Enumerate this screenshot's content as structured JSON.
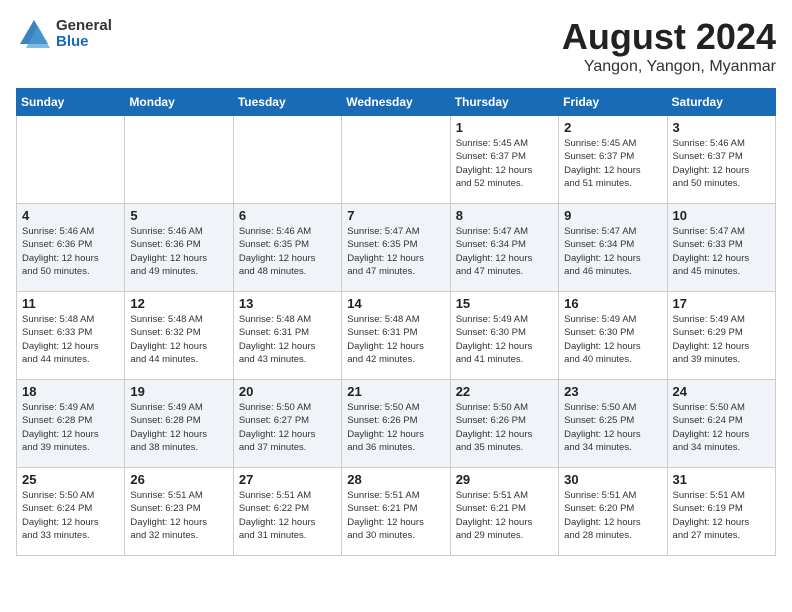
{
  "header": {
    "logo_general": "General",
    "logo_blue": "Blue",
    "month_year": "August 2024",
    "location": "Yangon, Yangon, Myanmar"
  },
  "days_of_week": [
    "Sunday",
    "Monday",
    "Tuesday",
    "Wednesday",
    "Thursday",
    "Friday",
    "Saturday"
  ],
  "weeks": [
    [
      {
        "day": "",
        "info": ""
      },
      {
        "day": "",
        "info": ""
      },
      {
        "day": "",
        "info": ""
      },
      {
        "day": "",
        "info": ""
      },
      {
        "day": "1",
        "info": "Sunrise: 5:45 AM\nSunset: 6:37 PM\nDaylight: 12 hours\nand 52 minutes."
      },
      {
        "day": "2",
        "info": "Sunrise: 5:45 AM\nSunset: 6:37 PM\nDaylight: 12 hours\nand 51 minutes."
      },
      {
        "day": "3",
        "info": "Sunrise: 5:46 AM\nSunset: 6:37 PM\nDaylight: 12 hours\nand 50 minutes."
      }
    ],
    [
      {
        "day": "4",
        "info": "Sunrise: 5:46 AM\nSunset: 6:36 PM\nDaylight: 12 hours\nand 50 minutes."
      },
      {
        "day": "5",
        "info": "Sunrise: 5:46 AM\nSunset: 6:36 PM\nDaylight: 12 hours\nand 49 minutes."
      },
      {
        "day": "6",
        "info": "Sunrise: 5:46 AM\nSunset: 6:35 PM\nDaylight: 12 hours\nand 48 minutes."
      },
      {
        "day": "7",
        "info": "Sunrise: 5:47 AM\nSunset: 6:35 PM\nDaylight: 12 hours\nand 47 minutes."
      },
      {
        "day": "8",
        "info": "Sunrise: 5:47 AM\nSunset: 6:34 PM\nDaylight: 12 hours\nand 47 minutes."
      },
      {
        "day": "9",
        "info": "Sunrise: 5:47 AM\nSunset: 6:34 PM\nDaylight: 12 hours\nand 46 minutes."
      },
      {
        "day": "10",
        "info": "Sunrise: 5:47 AM\nSunset: 6:33 PM\nDaylight: 12 hours\nand 45 minutes."
      }
    ],
    [
      {
        "day": "11",
        "info": "Sunrise: 5:48 AM\nSunset: 6:33 PM\nDaylight: 12 hours\nand 44 minutes."
      },
      {
        "day": "12",
        "info": "Sunrise: 5:48 AM\nSunset: 6:32 PM\nDaylight: 12 hours\nand 44 minutes."
      },
      {
        "day": "13",
        "info": "Sunrise: 5:48 AM\nSunset: 6:31 PM\nDaylight: 12 hours\nand 43 minutes."
      },
      {
        "day": "14",
        "info": "Sunrise: 5:48 AM\nSunset: 6:31 PM\nDaylight: 12 hours\nand 42 minutes."
      },
      {
        "day": "15",
        "info": "Sunrise: 5:49 AM\nSunset: 6:30 PM\nDaylight: 12 hours\nand 41 minutes."
      },
      {
        "day": "16",
        "info": "Sunrise: 5:49 AM\nSunset: 6:30 PM\nDaylight: 12 hours\nand 40 minutes."
      },
      {
        "day": "17",
        "info": "Sunrise: 5:49 AM\nSunset: 6:29 PM\nDaylight: 12 hours\nand 39 minutes."
      }
    ],
    [
      {
        "day": "18",
        "info": "Sunrise: 5:49 AM\nSunset: 6:28 PM\nDaylight: 12 hours\nand 39 minutes."
      },
      {
        "day": "19",
        "info": "Sunrise: 5:49 AM\nSunset: 6:28 PM\nDaylight: 12 hours\nand 38 minutes."
      },
      {
        "day": "20",
        "info": "Sunrise: 5:50 AM\nSunset: 6:27 PM\nDaylight: 12 hours\nand 37 minutes."
      },
      {
        "day": "21",
        "info": "Sunrise: 5:50 AM\nSunset: 6:26 PM\nDaylight: 12 hours\nand 36 minutes."
      },
      {
        "day": "22",
        "info": "Sunrise: 5:50 AM\nSunset: 6:26 PM\nDaylight: 12 hours\nand 35 minutes."
      },
      {
        "day": "23",
        "info": "Sunrise: 5:50 AM\nSunset: 6:25 PM\nDaylight: 12 hours\nand 34 minutes."
      },
      {
        "day": "24",
        "info": "Sunrise: 5:50 AM\nSunset: 6:24 PM\nDaylight: 12 hours\nand 34 minutes."
      }
    ],
    [
      {
        "day": "25",
        "info": "Sunrise: 5:50 AM\nSunset: 6:24 PM\nDaylight: 12 hours\nand 33 minutes."
      },
      {
        "day": "26",
        "info": "Sunrise: 5:51 AM\nSunset: 6:23 PM\nDaylight: 12 hours\nand 32 minutes."
      },
      {
        "day": "27",
        "info": "Sunrise: 5:51 AM\nSunset: 6:22 PM\nDaylight: 12 hours\nand 31 minutes."
      },
      {
        "day": "28",
        "info": "Sunrise: 5:51 AM\nSunset: 6:21 PM\nDaylight: 12 hours\nand 30 minutes."
      },
      {
        "day": "29",
        "info": "Sunrise: 5:51 AM\nSunset: 6:21 PM\nDaylight: 12 hours\nand 29 minutes."
      },
      {
        "day": "30",
        "info": "Sunrise: 5:51 AM\nSunset: 6:20 PM\nDaylight: 12 hours\nand 28 minutes."
      },
      {
        "day": "31",
        "info": "Sunrise: 5:51 AM\nSunset: 6:19 PM\nDaylight: 12 hours\nand 27 minutes."
      }
    ]
  ]
}
